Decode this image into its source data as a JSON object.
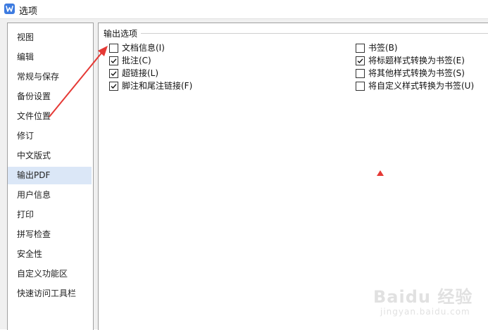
{
  "window": {
    "title": "选项"
  },
  "sidebar": {
    "items": [
      {
        "label": "视图"
      },
      {
        "label": "编辑"
      },
      {
        "label": "常规与保存"
      },
      {
        "label": "备份设置"
      },
      {
        "label": "文件位置"
      },
      {
        "label": "修订"
      },
      {
        "label": "中文版式"
      },
      {
        "label": "输出PDF",
        "selected": true
      },
      {
        "label": "用户信息"
      },
      {
        "label": "打印"
      },
      {
        "label": "拼写检查"
      },
      {
        "label": "安全性"
      },
      {
        "label": "自定义功能区"
      },
      {
        "label": "快速访问工具栏"
      }
    ]
  },
  "output_options": {
    "group_title": "输出选项",
    "left": [
      {
        "label": "文档信息(I)",
        "checked": false
      },
      {
        "label": "批注(C)",
        "checked": true
      },
      {
        "label": "超链接(L)",
        "checked": true
      },
      {
        "label": "脚注和尾注链接(F)",
        "checked": true
      }
    ],
    "right": [
      {
        "label": "书签(B)",
        "checked": false
      },
      {
        "label": "将标题样式转换为书签(E)",
        "checked": true
      },
      {
        "label": "将其他样式转换为书签(S)",
        "checked": false
      },
      {
        "label": "将自定义样式转换为书签(U)",
        "checked": false
      }
    ]
  },
  "annotation": {
    "color": "#e53935"
  },
  "watermark": {
    "logo_text": "Baidu 经验",
    "url_text": "jingyan.baidu.com"
  },
  "colors": {
    "accent": "#3d7be0",
    "selected_bg": "#dbe7f7"
  }
}
